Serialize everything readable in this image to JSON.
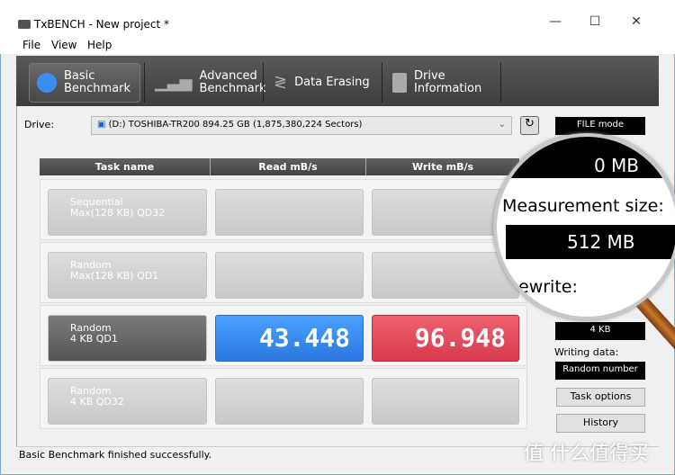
{
  "window": {
    "title": "TxBENCH - New project *",
    "controls": [
      "—",
      "☐",
      "✕"
    ]
  },
  "menu": [
    "File",
    "View",
    "Help"
  ],
  "tabs": [
    {
      "label1": "Basic",
      "label2": "Benchmark",
      "icon": "stopwatch-icon"
    },
    {
      "label1": "Advanced",
      "label2": "Benchmark",
      "icon": "bar-chart-icon"
    },
    {
      "label1": "Data Erasing",
      "label2": "",
      "icon": "eraser-icon"
    },
    {
      "label1": "Drive",
      "label2": "Information",
      "icon": "drive-info-icon"
    }
  ],
  "drive": {
    "label": "Drive:",
    "value": "(D:) TOSHIBA-TR200  894.25 GB (1,875,380,224 Sectors)"
  },
  "table": {
    "headers": [
      "Task name",
      "Read mB/s",
      "Write mB/s"
    ],
    "rows": [
      {
        "name1": "Sequential",
        "name2": "Max(128 KB) QD32",
        "read": "",
        "write": ""
      },
      {
        "name1": "Random",
        "name2": "Max(128 KB) QD1",
        "read": "",
        "write": ""
      },
      {
        "name1": "Random",
        "name2": "4 KB QD1",
        "read": "43.448",
        "write": "96.948"
      },
      {
        "name1": "Random",
        "name2": "4 KB QD32",
        "read": "",
        "write": ""
      }
    ]
  },
  "side": {
    "mode": "FILE mode",
    "alignment_value": "4 KB",
    "writing_label": "Writing data:",
    "writing_value": "Random number",
    "task_options": "Task options",
    "history": "History"
  },
  "magnifier": {
    "size_value": "0 MB",
    "measurement_label": "Measurement size:",
    "measurement_value": "512 MB",
    "rewrite_label": "ewrite:"
  },
  "status": "Basic Benchmark finished successfully.",
  "watermark": "值 什么值得买",
  "colors": {
    "read": "#3a8ef0",
    "write": "#e84a5a"
  }
}
